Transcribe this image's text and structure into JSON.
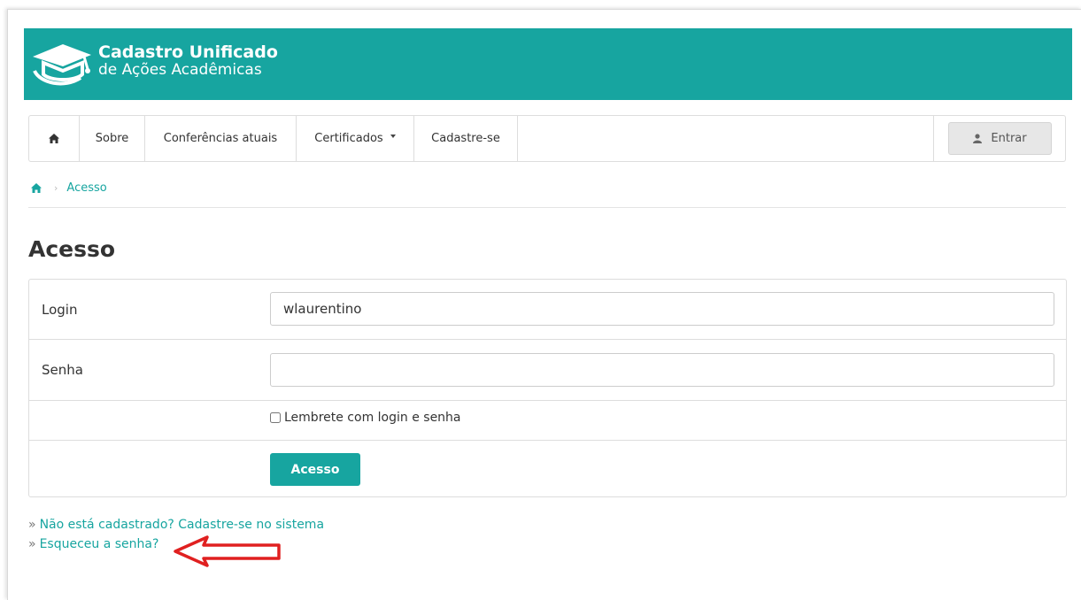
{
  "header": {
    "title": "Cadastro Unificado",
    "subtitle": "de Ações Acadêmicas",
    "color": "#17a5a0"
  },
  "nav": {
    "home_icon": "home-icon",
    "items": [
      {
        "label": "Sobre"
      },
      {
        "label": "Conferências atuais"
      },
      {
        "label": "Certificados",
        "has_dropdown": true
      },
      {
        "label": "Cadastre-se"
      }
    ],
    "login_label": "Entrar",
    "login_icon": "user-icon"
  },
  "breadcrumb": {
    "home_icon": "home-icon",
    "current": "Acesso"
  },
  "page": {
    "title": "Acesso"
  },
  "form": {
    "login_label": "Login",
    "login_value": "wlaurentino",
    "password_label": "Senha",
    "password_value": "",
    "remember_label": "Lembrete com login e senha",
    "remember_checked": false,
    "submit_label": "Acesso"
  },
  "links": {
    "register": "Não está cadastrado? Cadastre-se no sistema",
    "forgot": "Esqueceu a senha?",
    "prefix": "»"
  },
  "annotation": {
    "arrow_color": "#e02020"
  }
}
